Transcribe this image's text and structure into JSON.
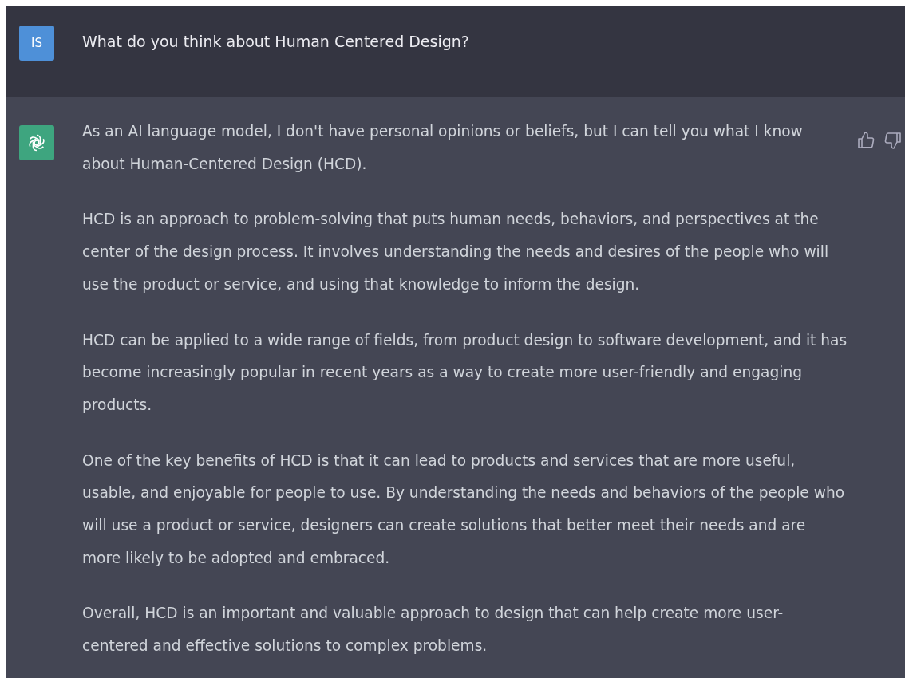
{
  "prompt": {
    "avatar": "IS",
    "text": "What do you think about Human Centered Design?"
  },
  "response": {
    "paragraphs": [
      "As an AI language model, I don't have personal opinions or beliefs, but I can tell you what I know about Human-Centered Design (HCD).",
      "HCD is an approach to problem-solving that puts human needs, behaviors, and perspectives at the center of the design process. It involves understanding the needs and desires of the people who will use the product or service, and using that knowledge to inform the design.",
      "HCD can be applied to a wide range of fields, from product design to software development, and it has become increasingly popular in recent years as a way to create more user-friendly and engaging products.",
      "One of the key benefits of HCD is that it can lead to products and services that are more useful, usable, and enjoyable for people to use. By understanding the needs and behaviors of the people who will use a product or service, designers can create solutions that better meet their needs and are more likely to be adopted and embraced.",
      "Overall, HCD is an important and valuable approach to design that can help create more user-centered and effective solutions to complex problems."
    ]
  }
}
